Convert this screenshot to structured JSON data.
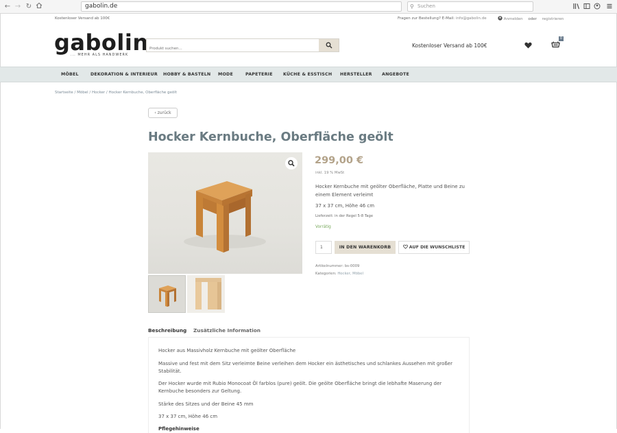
{
  "browser": {
    "url": "gabolin.de",
    "search_placeholder": "Suchen"
  },
  "topbar": {
    "shipping_note": "Kostenloser Versand ab 100€",
    "contact_text": "Fragen zur Bestellung? E-Mail:",
    "contact_email": "info@gabolin.de",
    "login": "Anmelden",
    "or": "oder",
    "register": "registrieren"
  },
  "header": {
    "logo_word": "gabolin",
    "logo_tagline": "... MEHR ALS HANDWERK",
    "search_placeholder": "Produkt suchen...",
    "shipping": "Kostenloser Versand ab 100€",
    "cart_count": "0"
  },
  "nav": {
    "items": [
      "MÖBEL",
      "DEKORATION & INTERIEUR",
      "HOBBY & BASTELN",
      "MODE",
      "PAPETERIE",
      "KÜCHE & ESSTISCH",
      "HERSTELLER",
      "ANGEBOTE"
    ]
  },
  "breadcrumb": "Startseite / Möbel / Hocker / Hocker Kernbuche, Oberfläche geölt",
  "back_label": "zurück",
  "product": {
    "title": "Hocker Kernbuche, Oberfläche geölt",
    "price": "299,00 €",
    "tax": "inkl. 19 % MwSt",
    "short_description": "Hocker Kernbuche mit geölter Oberfläche, Platte und Beine zu einem Element verleimt",
    "dimensions": "37 x 37 cm, Höhe 46 cm",
    "delivery": "Lieferzeit: in der Regel 5-8 Tage",
    "stock": "Vorrätig",
    "quantity": "1",
    "add_to_cart": "IN DEN WARENKORB",
    "wishlist": "AUF DIE WUNSCHLISTE",
    "sku_label": "Artikelnummer:",
    "sku": "bs-0009",
    "categories_label": "Kategorien:",
    "categories": "Hocker, Möbel"
  },
  "tabs": [
    "Beschreibung",
    "Zusätzliche Information"
  ],
  "description": {
    "p1": "Hocker aus Massivholz Kernbuche mit geölter Oberfläche",
    "p2": "Massive und fest mit dem Sitz verleimte Beine verleihen dem Hocker ein ästhetisches und schlankes Aussehen mit großer Stabilität.",
    "p3": "Der Hocker wurde mit Rubio Monocoat Öl farblos (pure) geölt. Die geölte Oberfläche bringt die lebhafte Maserung der Kernbuche besonders zur Geltung.",
    "p4": "Stärke des Sitzes und der Beine 45 mm",
    "p5": "37 x 37 cm, Höhe 46 cm",
    "p6": "Pflegehinweise"
  }
}
